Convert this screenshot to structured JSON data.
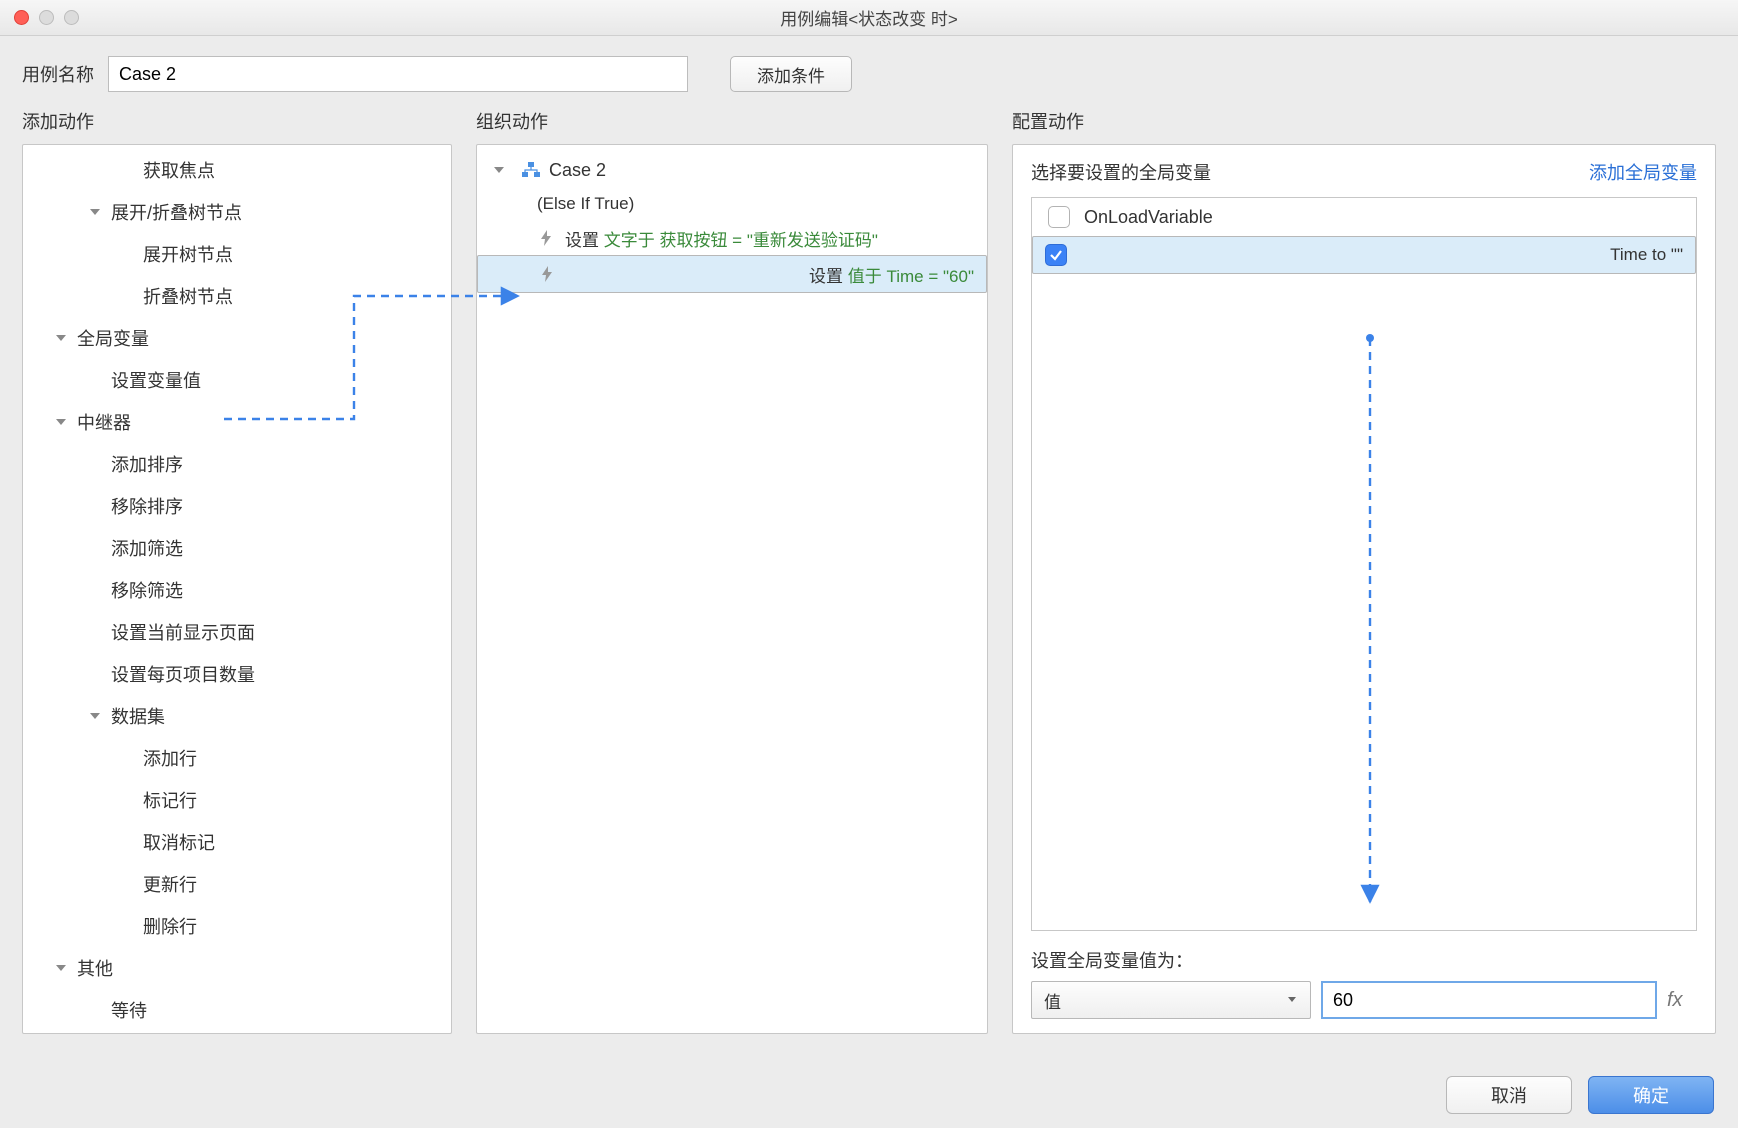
{
  "window": {
    "title": "用例编辑<状态改变 时>"
  },
  "top": {
    "case_label": "用例名称",
    "case_value": "Case 2",
    "add_condition": "添加条件"
  },
  "sections": {
    "add_action": "添加动作",
    "organize": "组织动作",
    "configure": "配置动作"
  },
  "action_tree": [
    {
      "label": "获取焦点",
      "indent": 2
    },
    {
      "label": "展开/折叠树节点",
      "indent": 1,
      "expanded": true
    },
    {
      "label": "展开树节点",
      "indent": 2
    },
    {
      "label": "折叠树节点",
      "indent": 2
    },
    {
      "label": "全局变量",
      "indent": 0,
      "expanded": true
    },
    {
      "label": "设置变量值",
      "indent": 1,
      "source_arrow": true
    },
    {
      "label": "中继器",
      "indent": 0,
      "expanded": true
    },
    {
      "label": "添加排序",
      "indent": 1
    },
    {
      "label": "移除排序",
      "indent": 1
    },
    {
      "label": "添加筛选",
      "indent": 1
    },
    {
      "label": "移除筛选",
      "indent": 1
    },
    {
      "label": "设置当前显示页面",
      "indent": 1
    },
    {
      "label": "设置每页项目数量",
      "indent": 1
    },
    {
      "label": "数据集",
      "indent": 1,
      "expanded": true
    },
    {
      "label": "添加行",
      "indent": 2
    },
    {
      "label": "标记行",
      "indent": 2
    },
    {
      "label": "取消标记",
      "indent": 2
    },
    {
      "label": "更新行",
      "indent": 2
    },
    {
      "label": "删除行",
      "indent": 2
    },
    {
      "label": "其他",
      "indent": 0,
      "expanded": true
    },
    {
      "label": "等待",
      "indent": 1
    }
  ],
  "organize": {
    "case_name": "Case 2",
    "case_condition": "(Else If True)",
    "actions": [
      {
        "prefix": "设置",
        "rest": " 文字于 获取按钮 = \"重新发送验证码\"",
        "selected": false
      },
      {
        "prefix": "设置",
        "rest": " 值于 Time = \"60\"",
        "selected": true
      }
    ]
  },
  "configure": {
    "header": "选择要设置的全局变量",
    "add_link": "添加全局变量",
    "variables": [
      {
        "name": "OnLoadVariable",
        "checked": false
      },
      {
        "name": "Time to \"\"",
        "checked": true
      }
    ],
    "set_label": "设置全局变量值为：",
    "mode": "值",
    "value": "60",
    "fx": "fx"
  },
  "footer": {
    "cancel": "取消",
    "ok": "确定"
  }
}
